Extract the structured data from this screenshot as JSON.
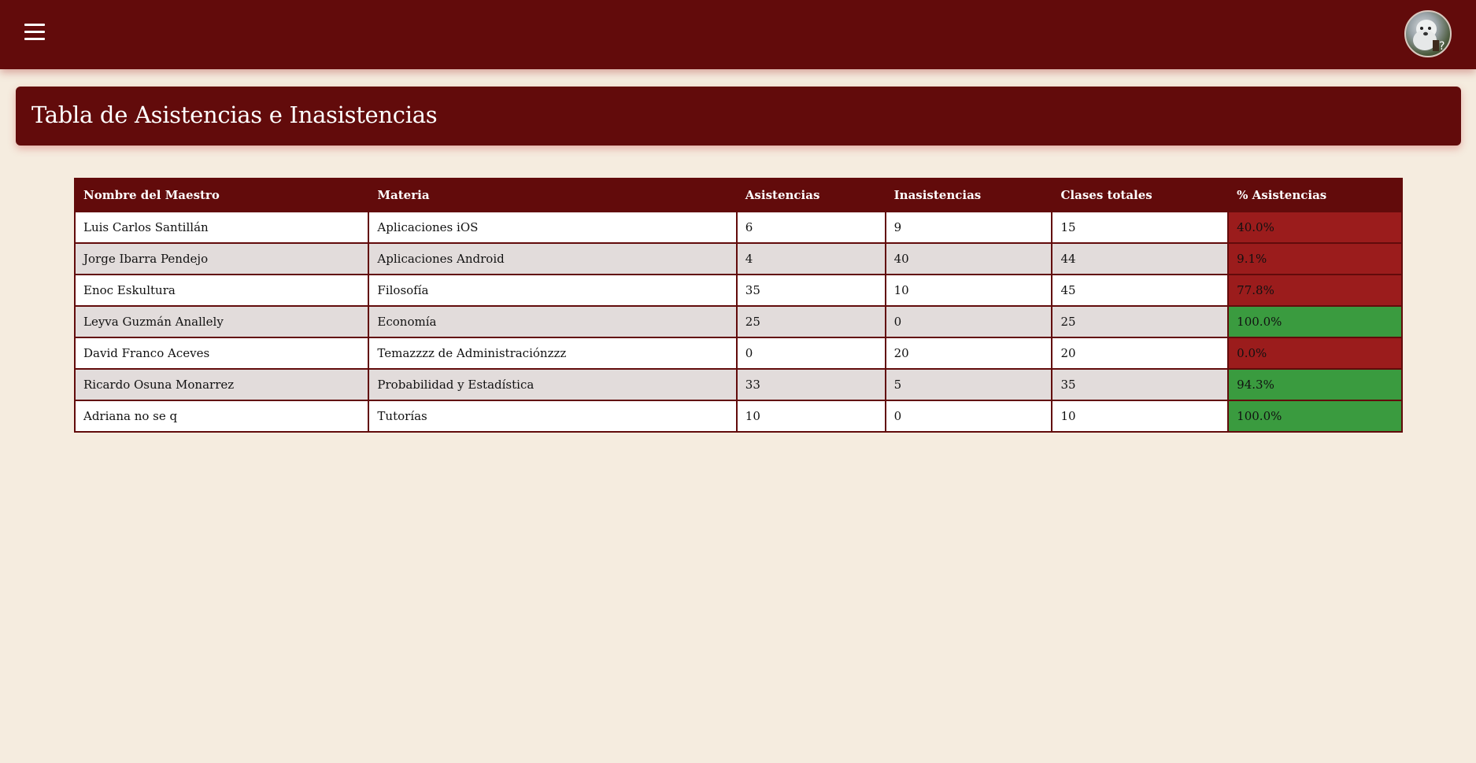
{
  "header": {
    "menu_icon": "hamburger-menu-icon",
    "avatar_icon": "dog-avatar"
  },
  "page": {
    "title": "Tabla de Asistencias e Inasistencias"
  },
  "table": {
    "columns": [
      "Nombre del Maestro",
      "Materia",
      "Asistencias",
      "Inasistencias",
      "Clases totales",
      "% Asistencias"
    ],
    "rows": [
      {
        "teacher": "Luis Carlos Santillán",
        "subject": "Aplicaciones iOS",
        "attendances": "6",
        "absences": "9",
        "total": "15",
        "percent": "40.0%",
        "status": "low"
      },
      {
        "teacher": "Jorge Ibarra Pendejo",
        "subject": "Aplicaciones Android",
        "attendances": "4",
        "absences": "40",
        "total": "44",
        "percent": "9.1%",
        "status": "low"
      },
      {
        "teacher": "Enoc Eskultura",
        "subject": "Filosofía",
        "attendances": "35",
        "absences": "10",
        "total": "45",
        "percent": "77.8%",
        "status": "low"
      },
      {
        "teacher": "Leyva Guzmán Anallely",
        "subject": "Economía",
        "attendances": "25",
        "absences": "0",
        "total": "25",
        "percent": "100.0%",
        "status": "high"
      },
      {
        "teacher": "David Franco Aceves",
        "subject": "Temazzzz de Administraciónzzz",
        "attendances": "0",
        "absences": "20",
        "total": "20",
        "percent": "0.0%",
        "status": "low"
      },
      {
        "teacher": "Ricardo Osuna Monarrez",
        "subject": "Probabilidad y Estadística",
        "attendances": "33",
        "absences": "5",
        "total": "35",
        "percent": "94.3%",
        "status": "high"
      },
      {
        "teacher": "Adriana no se q",
        "subject": "Tutorías",
        "attendances": "10",
        "absences": "0",
        "total": "10",
        "percent": "100.0%",
        "status": "high"
      }
    ]
  },
  "colors": {
    "primary": "#620b0b",
    "background": "#f5ecdf",
    "low": "#9b1c1c",
    "high": "#3a9b3f",
    "row_alt": "#e2dcdb"
  }
}
